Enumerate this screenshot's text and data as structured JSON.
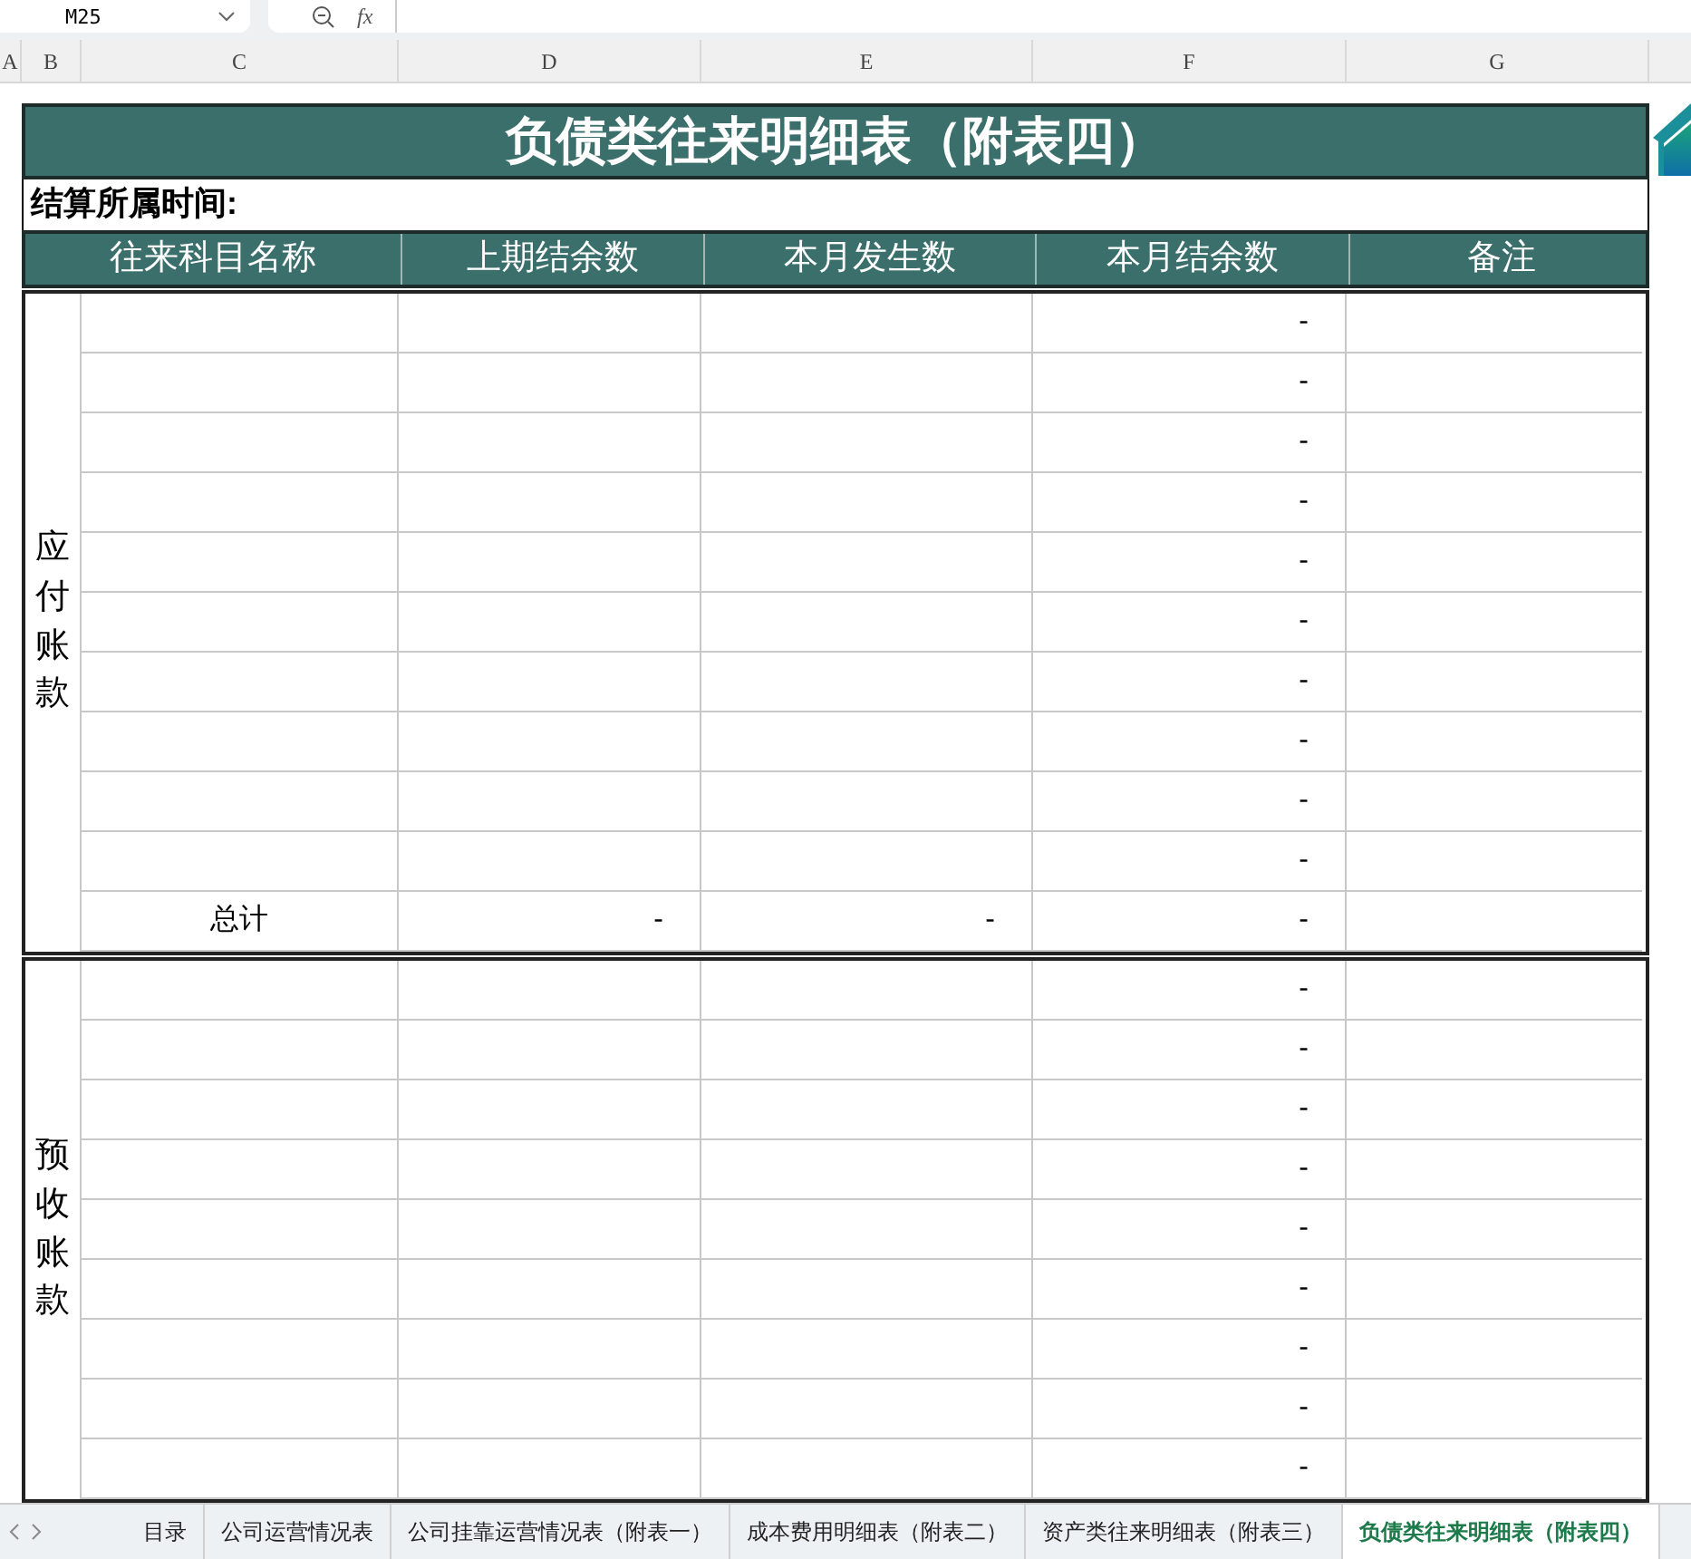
{
  "toolbar": {
    "cell_ref": "M25",
    "fx": "fx"
  },
  "column_headers": [
    "A",
    "B",
    "C",
    "D",
    "E",
    "F",
    "G"
  ],
  "sheet": {
    "title": "负债类往来明细表（附表四）",
    "period_label": "结算所属时间:",
    "headers": [
      "往来科目名称",
      "上期结余数",
      "本月发生数",
      "本月结余数",
      "备注"
    ],
    "sections": [
      {
        "label": "应付账款",
        "rows": [
          {
            "balance": "-"
          },
          {
            "balance": "-"
          },
          {
            "balance": "-"
          },
          {
            "balance": "-"
          },
          {
            "balance": "-"
          },
          {
            "balance": "-"
          },
          {
            "balance": "-"
          },
          {
            "balance": "-"
          },
          {
            "balance": "-"
          },
          {
            "balance": "-"
          }
        ],
        "total": {
          "label": "总计",
          "values": [
            "-",
            "-",
            "-"
          ]
        }
      },
      {
        "label": "预收账款",
        "rows": [
          {
            "balance": "-"
          },
          {
            "balance": "-"
          },
          {
            "balance": "-"
          },
          {
            "balance": "-"
          },
          {
            "balance": "-"
          },
          {
            "balance": "-"
          },
          {
            "balance": "-"
          },
          {
            "balance": "-"
          },
          {
            "balance": "-"
          }
        ]
      }
    ]
  },
  "sheet_tabs": [
    {
      "label": "目录",
      "selected": false
    },
    {
      "label": "公司运营情况表",
      "selected": false
    },
    {
      "label": "公司挂靠运营情况表（附表一）",
      "selected": false
    },
    {
      "label": "成本费用明细表（附表二）",
      "selected": false
    },
    {
      "label": "资产类往来明细表（附表三）",
      "selected": false
    },
    {
      "label": "负债类往来明细表（附表四）",
      "selected": true
    }
  ]
}
